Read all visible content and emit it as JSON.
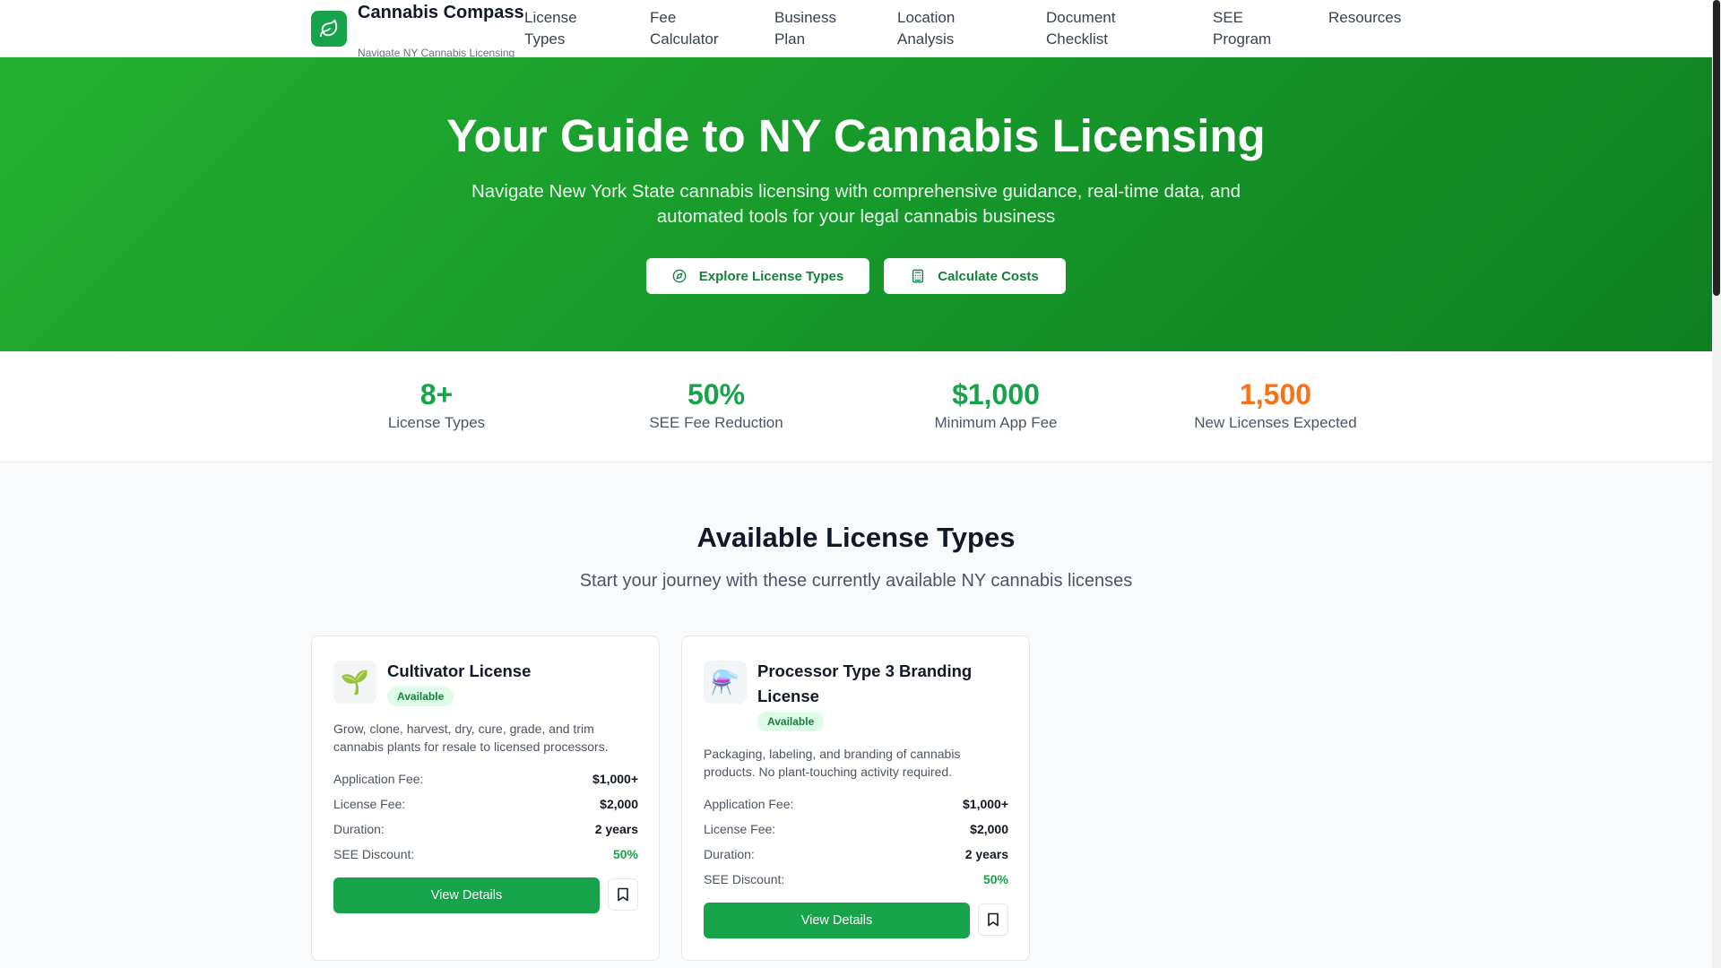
{
  "header": {
    "brand_name": "Cannabis Compass",
    "brand_tagline": "Navigate NY Cannabis Licensing",
    "nav": {
      "license_types": "License Types",
      "fee_calculator": "Fee Calculator",
      "business_plan": "Business Plan",
      "location_analysis": "Location Analysis",
      "document_checklist": "Document Checklist",
      "see_program": "SEE Program",
      "resources": "Resources"
    }
  },
  "hero": {
    "title": "Your Guide to NY Cannabis Licensing",
    "subtitle": "Navigate New York State cannabis licensing with comprehensive guidance, real-time data, and automated tools for your legal cannabis business",
    "primary_button": "Explore License Types",
    "secondary_button": "Calculate Costs"
  },
  "stats": [
    {
      "value": "8+",
      "label": "License Types",
      "color": "#16a34a"
    },
    {
      "value": "50%",
      "label": "SEE Fee Reduction",
      "color": "#16a34a"
    },
    {
      "value": "$1,000",
      "label": "Minimum App Fee",
      "color": "#16a34a"
    },
    {
      "value": "1,500",
      "label": "New Licenses Expected",
      "color": "#f97316"
    }
  ],
  "licenses_section": {
    "title": "Available License Types",
    "subtitle": "Start your journey with these currently available NY cannabis licenses",
    "cards": [
      {
        "icon": "🌱",
        "title": "Cultivator License",
        "status": "Available",
        "description": "Grow, clone, harvest, dry, cure, grade, and trim cannabis plants for resale to licensed processors.",
        "application_fee_label": "Application Fee:",
        "application_fee": "$1,000+",
        "license_fee_label": "License Fee:",
        "license_fee": "$2,000",
        "duration_label": "Duration:",
        "duration": "2 years",
        "see_discount_label": "SEE Discount:",
        "see_discount": "50%",
        "view_button": "View Details"
      },
      {
        "icon": "⚗️",
        "title": "Processor Type 3 Branding License",
        "status": "Available",
        "description": "Packaging, labeling, and branding of cannabis products. No plant-touching activity required.",
        "application_fee_label": "Application Fee:",
        "application_fee": "$1,000+",
        "license_fee_label": "License Fee:",
        "license_fee": "$2,000",
        "duration_label": "Duration:",
        "duration": "2 years",
        "see_discount_label": "SEE Discount:",
        "see_discount": "50%",
        "view_button": "View Details"
      }
    ]
  },
  "colors": {
    "brand": "#16a34a",
    "hero_start": "#22b030",
    "hero_end": "#0f7f1f",
    "accent_orange": "#f97316",
    "badge_bg": "#dcfce7"
  },
  "icons": {
    "brand": "leaf-icon",
    "explore": "compass-icon",
    "calculate": "calculator-icon",
    "save": "bookmark-icon"
  }
}
